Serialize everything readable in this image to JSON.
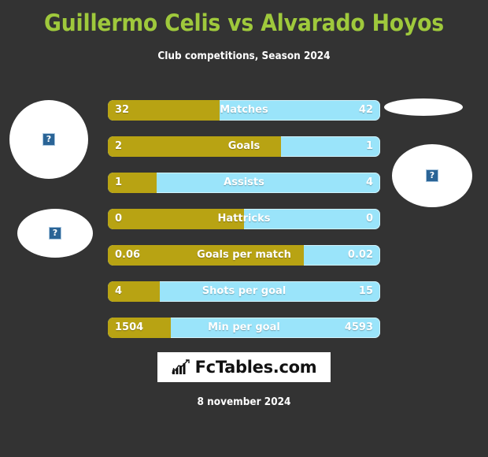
{
  "header": {
    "title": "Guillermo Celis vs Alvarado Hoyos",
    "subtitle": "Club competitions, Season 2024",
    "title_color": "#9fc93c"
  },
  "theme": {
    "background": "#333333",
    "home_color": "#b8a313",
    "away_color": "#9ae4fa",
    "text_color": "#ffffff"
  },
  "media": {
    "photo_left": {
      "alt": "?",
      "icon": "broken-image-icon"
    },
    "flag_left": {
      "alt": "?",
      "icon": "broken-image-icon"
    },
    "flag_right": {
      "alt": "",
      "icon": "broken-image-icon"
    },
    "photo_right": {
      "alt": "?",
      "icon": "broken-image-icon"
    }
  },
  "chart_data": {
    "type": "bar",
    "title": "Guillermo Celis vs Alvarado Hoyos",
    "subtitle": "Club competitions, Season 2024",
    "orientation": "horizontal-diverging",
    "series": [
      {
        "name": "Guillermo Celis",
        "color": "#b8a313",
        "values": [
          32,
          2,
          1,
          0,
          0.06,
          4,
          1504
        ]
      },
      {
        "name": "Alvarado Hoyos",
        "color": "#9ae4fa",
        "values": [
          42,
          1,
          4,
          0,
          0.02,
          15,
          4593
        ]
      }
    ],
    "categories": [
      "Matches",
      "Goals",
      "Assists",
      "Hattricks",
      "Goals per match",
      "Shots per goal",
      "Min per goal"
    ],
    "rows": [
      {
        "label": "Matches",
        "home": "32",
        "away": "42",
        "home_pct": 41
      },
      {
        "label": "Goals",
        "home": "2",
        "away": "1",
        "home_pct": 63.5
      },
      {
        "label": "Assists",
        "home": "1",
        "away": "4",
        "home_pct": 18
      },
      {
        "label": "Hattricks",
        "home": "0",
        "away": "0",
        "home_pct": 50
      },
      {
        "label": "Goals per match",
        "home": "0.06",
        "away": "0.02",
        "home_pct": 72
      },
      {
        "label": "Shots per goal",
        "home": "4",
        "away": "15",
        "home_pct": 19
      },
      {
        "label": "Min per goal",
        "home": "1504",
        "away": "4593",
        "home_pct": 23
      }
    ]
  },
  "footer": {
    "logo_text": "FcTables.com",
    "logo_icon": "bar-chart-arrow-icon",
    "date": "8 november 2024"
  }
}
